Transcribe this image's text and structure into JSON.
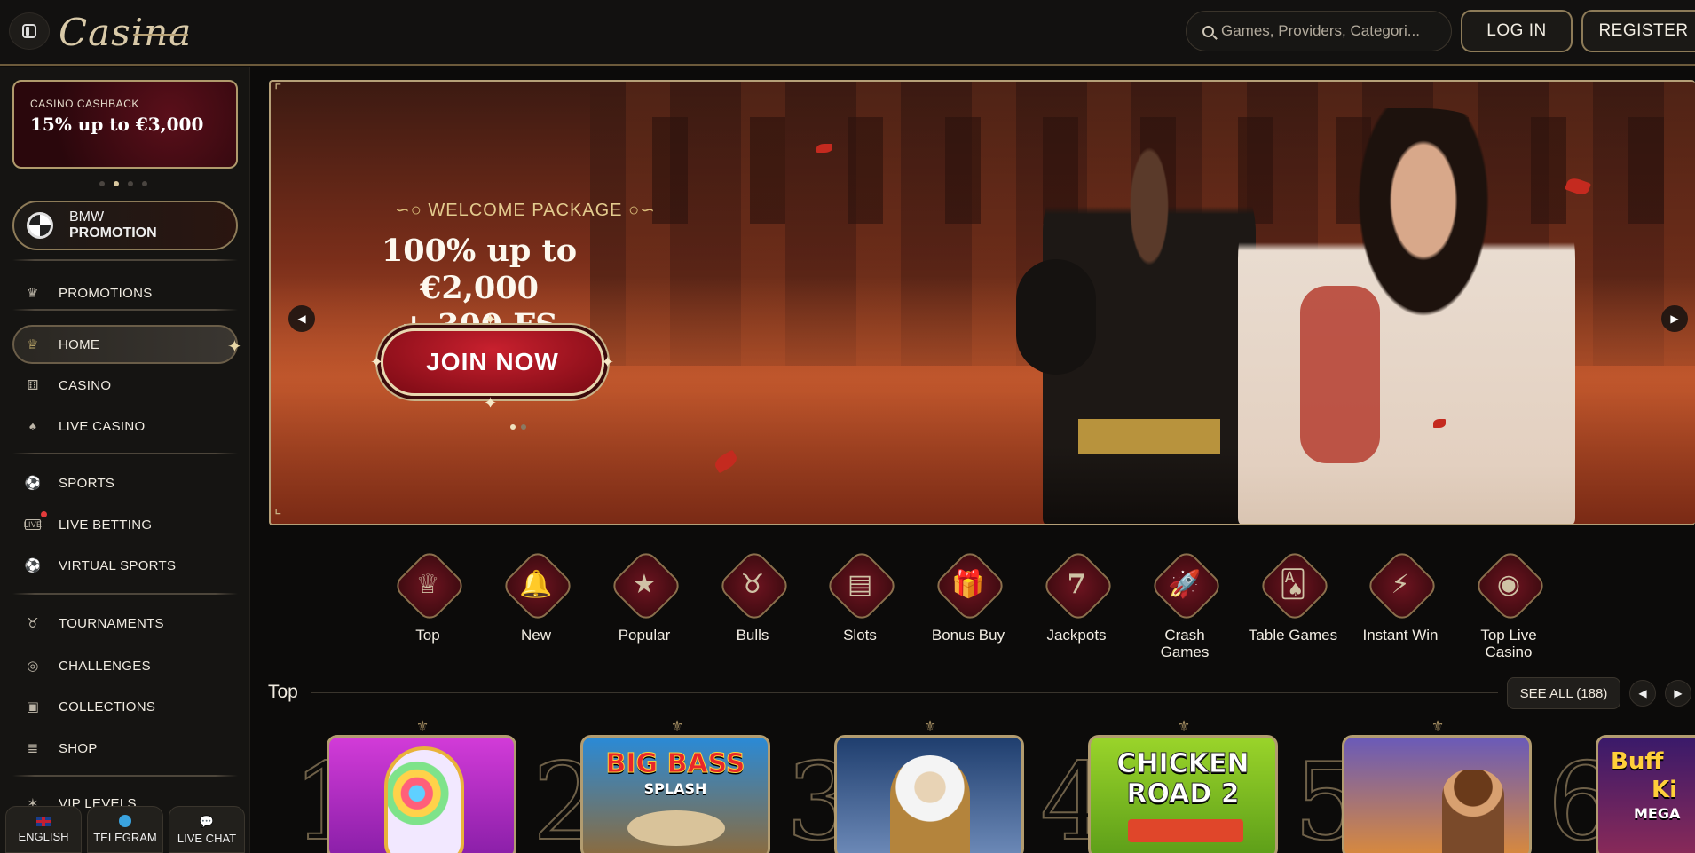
{
  "header": {
    "logo_text": "Casina",
    "search_placeholder": "Games, Providers, Categori...",
    "login_label": "LOG IN",
    "register_label": "REGISTER"
  },
  "sidebar": {
    "cashback_small": "CASINO CASHBACK",
    "cashback_big": "15% up to €3,000",
    "bmw_line1": "BMW",
    "bmw_line2": "PROMOTION",
    "items": {
      "promotions": "PROMOTIONS",
      "home": "HOME",
      "casino": "CASINO",
      "live_casino": "LIVE CASINO",
      "sports": "SPORTS",
      "live_betting": "LIVE BETTING",
      "virtual_sports": "VIRTUAL SPORTS",
      "tournaments": "TOURNAMENTS",
      "challenges": "CHALLENGES",
      "collections": "COLLECTIONS",
      "shop": "SHOP",
      "vip_levels": "VIP LEVELS"
    },
    "bottom": {
      "english": "ENGLISH",
      "telegram": "TELEGRAM",
      "live_chat": "LIVE CHAT"
    }
  },
  "hero": {
    "welcome": "WELCOME PACKAGE",
    "offer_line1": "100% up to €2,000",
    "offer_line2": "+ 300 FS",
    "cta": "JOIN NOW"
  },
  "categories": {
    "top": "Top",
    "new": "New",
    "popular": "Popular",
    "bulls": "Bulls",
    "slots": "Slots",
    "bonus_buy": "Bonus Buy",
    "jackpots": "Jackpots",
    "crash_1": "Crash",
    "crash_2": "Games",
    "table_games": "Table Games",
    "instant_win": "Instant Win",
    "top_live_1": "Top Live",
    "top_live_2": "Casino"
  },
  "top_section": {
    "title": "Top",
    "see_all": "SEE ALL (188)",
    "ranks": [
      "1",
      "2",
      "3",
      "4",
      "5",
      "6"
    ],
    "cards": {
      "big_bass_1": "BIG BASS",
      "big_bass_2": "SPLASH",
      "chicken_1": "CHICKEN",
      "chicken_2": "ROAD 2",
      "buffalo_1": "Buff",
      "buffalo_2": "Ki",
      "buffalo_3": "MEGA"
    }
  },
  "colors": {
    "gold_border": "#b5a078",
    "brand_red": "#7a0a14",
    "background": "#0c0b0a"
  },
  "icons": {
    "search": "search-icon",
    "sidebar_toggle": "sidebar-toggle-icon"
  }
}
